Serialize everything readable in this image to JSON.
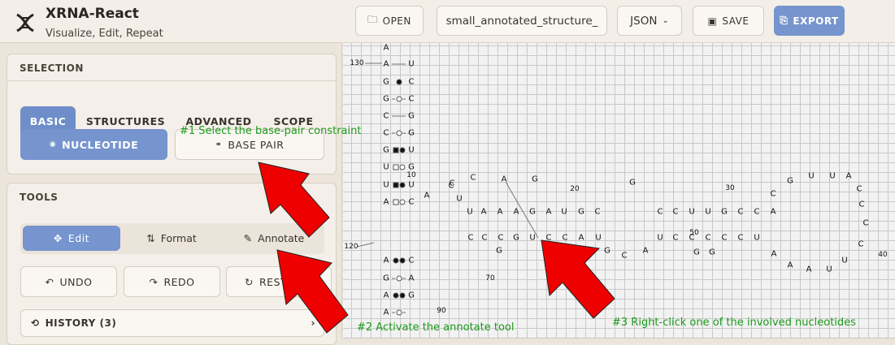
{
  "header": {
    "title": "XRNA-React",
    "subtitle": "Visualize, Edit, Repeat",
    "open_label": "OPEN",
    "filename": "small_annotated_structure_",
    "format": "JSON",
    "save_label": "SAVE",
    "export_label": "EXPORT"
  },
  "selection": {
    "title": "SELECTION",
    "tabs": [
      "BASIC",
      "STRUCTURES",
      "ADVANCED",
      "SCOPE"
    ],
    "nucleotide_label": "NUCLEOTIDE",
    "basepair_label": "BASE PAIR"
  },
  "tools": {
    "title": "TOOLS",
    "edit_label": "Edit",
    "format_label": "Format",
    "annotate_label": "Annotate",
    "undo_label": "UNDO",
    "redo_label": "REDO",
    "reset_label": "REST"
  },
  "history": {
    "label": "HISTORY (3)"
  },
  "annotations": {
    "step1": "#1 Select the base-pair constraint",
    "step2": "#2 Activate the annotate tool",
    "step3": "#3 Right-click one of the involved nucleotides"
  },
  "colors": {
    "accent": "#7694cd",
    "annotation": "#1c9a1c",
    "arrow": "#ee0000"
  },
  "structure": {
    "nucleotides": [
      "A",
      "A",
      "U",
      "G",
      "C",
      "G",
      "C",
      "C",
      "G",
      "C",
      "G",
      "G",
      "U",
      "U",
      "G",
      "U",
      "U",
      "A",
      "C",
      "A",
      "C",
      "U",
      "U",
      "A",
      "A",
      "A",
      "G",
      "A",
      "U",
      "G",
      "C",
      "C",
      "C",
      "A",
      "G",
      "G",
      "C",
      "C",
      "U",
      "U",
      "G",
      "C",
      "C",
      "A",
      "C",
      "C",
      "C",
      "G",
      "U",
      "C",
      "C",
      "A",
      "U",
      "U",
      "C",
      "C",
      "C",
      "C",
      "C",
      "U",
      "G",
      "G",
      "C",
      "A",
      "G",
      "G",
      "A",
      "A",
      "A",
      "U",
      "U",
      "C",
      "C",
      "C",
      "C",
      "A",
      "U",
      "U",
      "G",
      "C",
      "A",
      "C",
      "G",
      "A",
      "A",
      "G",
      "A"
    ],
    "index_labels": [
      "130",
      "10",
      "20",
      "30",
      "120",
      "50",
      "40",
      "70",
      "90"
    ]
  }
}
